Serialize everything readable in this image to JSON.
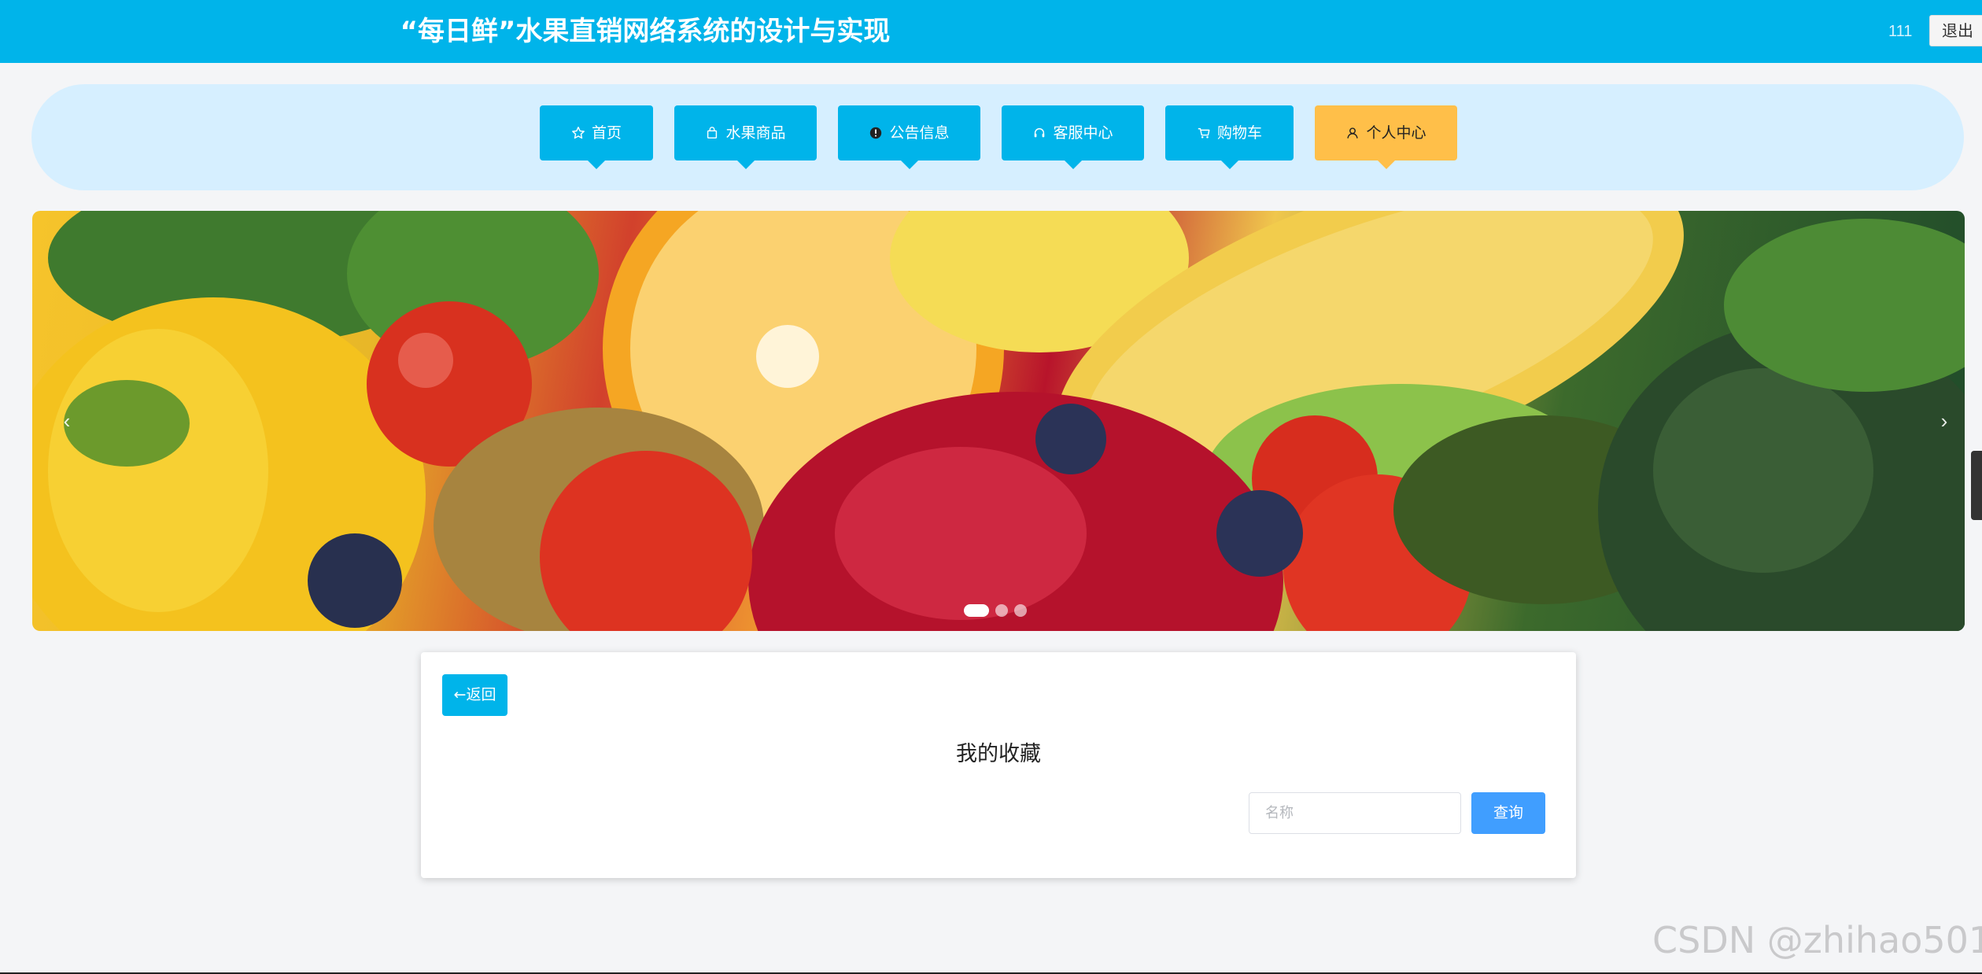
{
  "header": {
    "title": "“每日鲜”水果直销网络系统的设计与实现",
    "user_name": "111",
    "logout_label": "退出"
  },
  "nav": {
    "items": [
      {
        "label": "首页",
        "icon": "star-icon"
      },
      {
        "label": "水果商品",
        "icon": "bag-icon"
      },
      {
        "label": "公告信息",
        "icon": "info-icon"
      },
      {
        "label": "客服中心",
        "icon": "headset-icon"
      },
      {
        "label": "购物车",
        "icon": "cart-icon"
      },
      {
        "label": "个人中心",
        "icon": "user-icon",
        "active": true
      }
    ]
  },
  "banner": {
    "prev_arrow": "‹",
    "next_arrow": "›",
    "slide_count": 3,
    "active_slide": 1
  },
  "card": {
    "back_label": "←返回",
    "title": "我的收藏",
    "search_placeholder": "名称",
    "search_button_label": "查询"
  },
  "watermark": "CSDN @zhihao501",
  "colors": {
    "primary": "#00b4ea",
    "active_nav": "#ffbf49",
    "search_button": "#409eff",
    "nav_panel_bg": "#d6efff"
  }
}
